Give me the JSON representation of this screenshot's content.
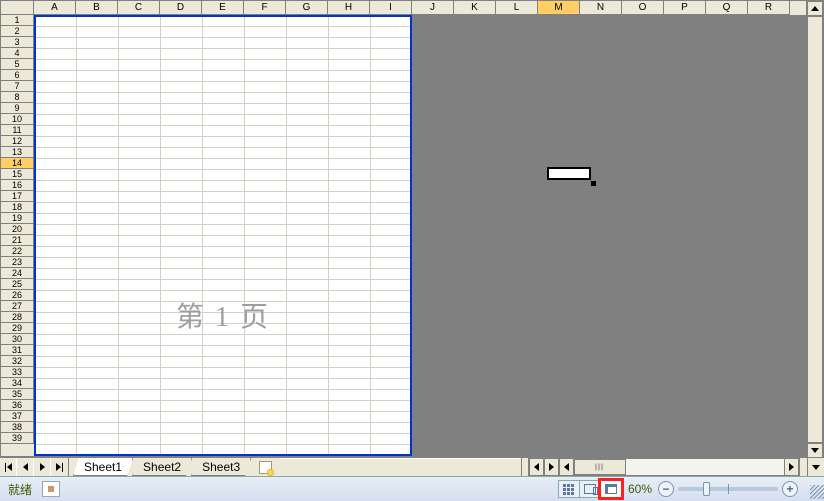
{
  "columns": [
    "A",
    "B",
    "C",
    "D",
    "E",
    "F",
    "G",
    "H",
    "I",
    "J",
    "K",
    "L",
    "M",
    "N",
    "O",
    "P",
    "Q",
    "R"
  ],
  "selected_column_index": 12,
  "row_count": 39,
  "selected_row_index": 13,
  "page_break_col_index": 9,
  "watermark": "第 1 页",
  "active_cell": "M14",
  "tabs": [
    "Sheet1",
    "Sheet2",
    "Sheet3"
  ],
  "active_tab_index": 0,
  "status": {
    "ready": "就绪"
  },
  "zoom": {
    "label": "60%",
    "value": 60,
    "min": 10,
    "max": 400
  },
  "view_mode": "page_break_preview",
  "colors": {
    "page_break": "#0033cc",
    "watermark": "#9e9e9e",
    "header_bg": "#ece9d8",
    "header_sel": "#ffcf66",
    "grey_area": "#808080"
  }
}
